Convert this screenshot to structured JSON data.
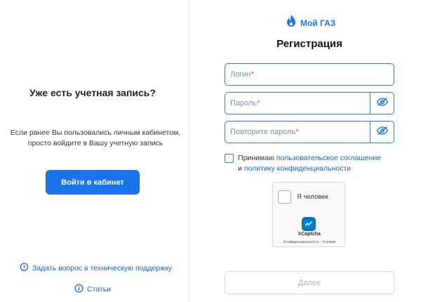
{
  "left": {
    "heading": "Уже есть учетная запись?",
    "description_line1": "Если ранее Вы пользовались личным кабинетом,",
    "description_line2": "просто войдите в Вашу учетную запись",
    "login_button": "Войти в кабинет",
    "support_link": "Задать вопрос в техническую поддержку",
    "articles_link": "Статьи"
  },
  "right": {
    "logo_text": "Мой ГАЗ",
    "title": "Регистрация",
    "fields": {
      "login": {
        "placeholder": "Логин",
        "required_mark": "*",
        "value": ""
      },
      "password": {
        "placeholder": "Пароль",
        "required_mark": "*",
        "value": ""
      },
      "password_repeat": {
        "placeholder": "Повторите пароль",
        "required_mark": "*",
        "value": ""
      }
    },
    "agreement": {
      "text_start": "Принимаю ",
      "user_agreement_link": "пользовательское соглашение",
      "and": "и ",
      "privacy_link": "политику конфиденциальности",
      "checked": false
    },
    "captcha": {
      "label": "Я человек",
      "brand": "hCaptcha",
      "footer": "Конфиденциальность - Условия"
    },
    "next_button": "Далее"
  },
  "colors": {
    "accent": "#1a73e8",
    "link": "#1a5fd0",
    "field_border": "#2f7de6",
    "required": "#e04848",
    "disabled_text": "#b0b0b0"
  }
}
